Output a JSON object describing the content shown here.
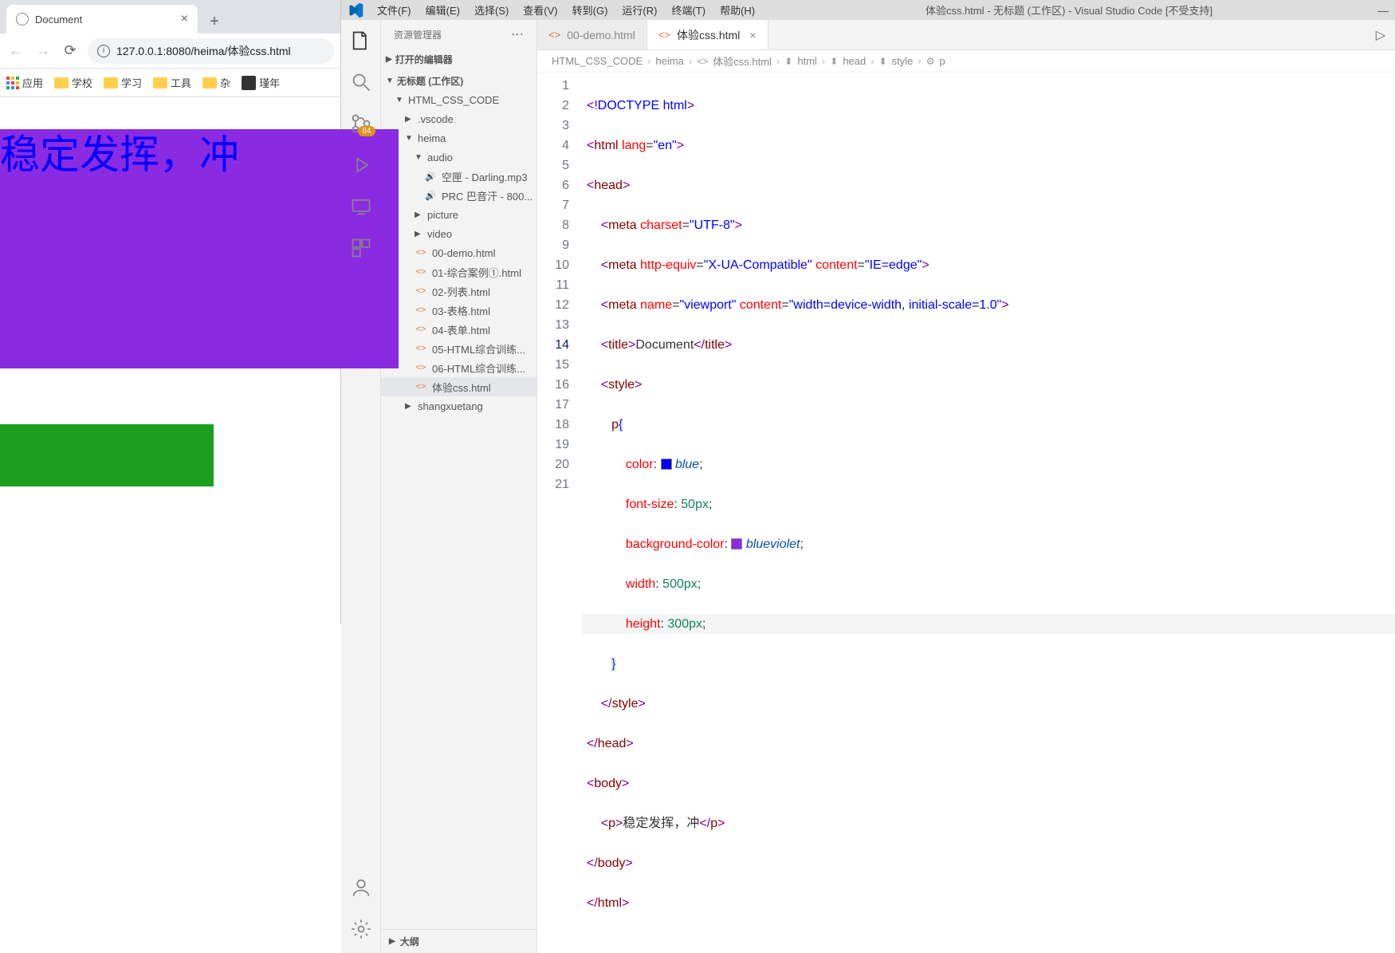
{
  "chrome": {
    "tab_title": "Document",
    "url": "127.0.0.1:8080/heima/体验css.html",
    "bookmarks": {
      "apps": "应用",
      "items": [
        "学校",
        "学习",
        "工具",
        "杂"
      ],
      "profile": "瑾年"
    },
    "rendered_text": "稳定发挥，冲"
  },
  "vscode": {
    "menus": [
      "文件(F)",
      "编辑(E)",
      "选择(S)",
      "查看(V)",
      "转到(G)",
      "运行(R)",
      "终端(T)",
      "帮助(H)"
    ],
    "window_title": "体验css.html - 无标题 (工作区) - Visual Studio Code [不受支持]",
    "scm_badge": "64",
    "sidebar": {
      "header": "资源管理器",
      "open_editors": "打开的编辑器",
      "workspace": "无标题 (工作区)",
      "tree": {
        "root": "HTML_CSS_CODE",
        "vscode": ".vscode",
        "heima": "heima",
        "audio": "audio",
        "audio_files": [
          "空匣 - Darling.mp3",
          "PRC 巴音汗 - 800..."
        ],
        "picture": "picture",
        "video": "video",
        "files": [
          "00-demo.html",
          "01-综合案例①.html",
          "02-列表.html",
          "03-表格.html",
          "04-表单.html",
          "05-HTML综合训练...",
          "06-HTML综合训练...",
          "体验css.html"
        ],
        "shangxuetang": "shangxuetang"
      },
      "outline": "大纲"
    },
    "tabs": {
      "t1": "00-demo.html",
      "t2": "体验css.html"
    },
    "breadcrumb": {
      "p1": "HTML_CSS_CODE",
      "p2": "heima",
      "p3": "体验css.html",
      "p4": "html",
      "p5": "head",
      "p6": "style",
      "p7": "p"
    },
    "code": {
      "doctype": "DOCTYPE",
      "html": "html",
      "lang_attr": "lang",
      "lang_val": "\"en\"",
      "head": "head",
      "meta": "meta",
      "charset_attr": "charset",
      "charset_val": "\"UTF-8\"",
      "httpequiv_attr": "http-equiv",
      "httpequiv_val": "\"X-UA-Compatible\"",
      "content_attr": "content",
      "ie_val": "\"IE=edge\"",
      "name_attr": "name",
      "viewport_val": "\"viewport\"",
      "viewport_content": "\"width=device-width, initial-scale=1.0\"",
      "title_tag": "title",
      "title_text": "Document",
      "style_tag": "style",
      "selector": "p",
      "color_prop": "color",
      "color_val": "blue",
      "fontsize_prop": "font-size",
      "fontsize_val": "50px",
      "bg_prop": "background-color",
      "bg_val": "blueviolet",
      "width_prop": "width",
      "width_val": "500px",
      "height_prop": "height",
      "height_val": "300px",
      "body": "body",
      "p_tag": "p",
      "p_text": "稳定发挥，冲"
    },
    "line_numbers": [
      "1",
      "2",
      "3",
      "4",
      "5",
      "6",
      "7",
      "8",
      "9",
      "10",
      "11",
      "12",
      "13",
      "14",
      "15",
      "16",
      "17",
      "18",
      "19",
      "20",
      "21"
    ]
  }
}
